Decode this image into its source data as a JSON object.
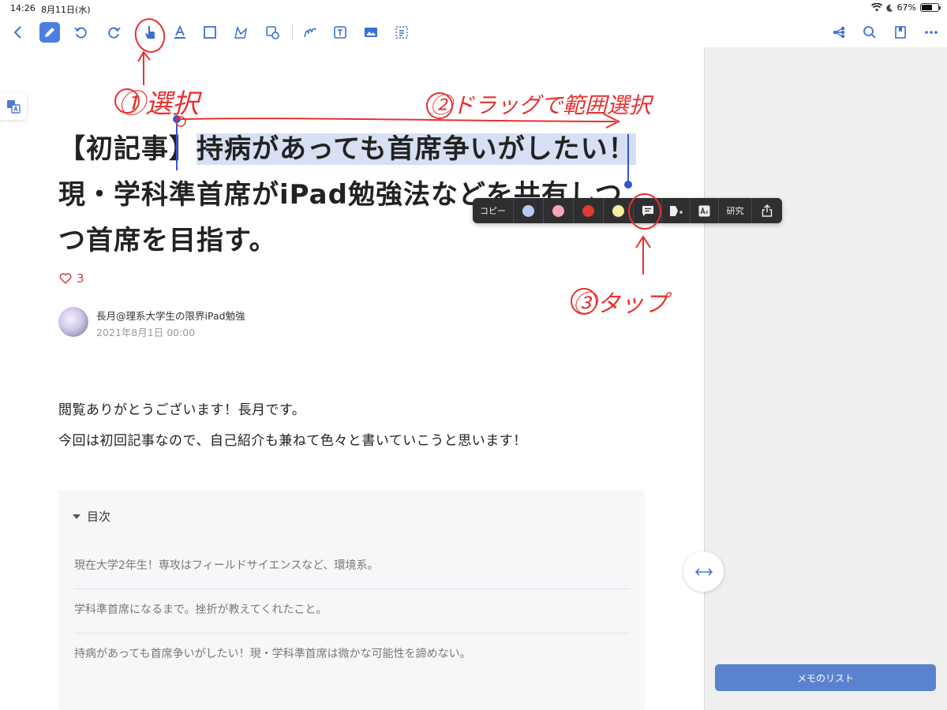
{
  "status_bar": {
    "time": "14:26",
    "date": "8月11日(水)",
    "battery": "67%",
    "battery_level": 0.67
  },
  "toolbar": {
    "left_icons": [
      "back-icon",
      "pen-icon",
      "undo-icon",
      "redo-icon",
      "pointer-hand-icon",
      "highlighter-icon",
      "rectangle-select-icon",
      "lasso-icon",
      "image-settings-icon",
      "freehand-icon",
      "text-box-icon",
      "image-icon",
      "scan-icon"
    ],
    "right_icons": [
      "share-icon",
      "search-icon",
      "bookmark-icon",
      "more-icon"
    ]
  },
  "article": {
    "title_prefix": "【初記事】",
    "title_highlighted": "持病があっても首席争いがしたい！",
    "title_line2": "現・学科準首席がiPad勉強法などを共有しつ",
    "title_line3": "つ首席を目指す。",
    "likes": "3",
    "author": "長月@理系大学生の限界iPad勉強",
    "date": "2021年8月1日 00:00",
    "para1": "閲覧ありがとうございます！長月です。",
    "para2": "今回は初回記事なので、自己紹介も兼ねて色々と書いていこうと思います！"
  },
  "toc": {
    "heading": "目次",
    "items": [
      "現在大学2年生！専攻はフィールドサイエンスなど、環境系。",
      "学科準首席になるまで。挫折が教えてくれたこと。",
      "持病があっても首席争いがしたい！現・学科準首席は微かな可能性を諦めない。"
    ]
  },
  "popup_menu": {
    "copy_label": "コピー",
    "colors": [
      "#b9c9f3",
      "#f2a6b6",
      "#e03a31",
      "#f8ee9e"
    ],
    "research_label": "研究"
  },
  "annotations": {
    "step1": "①選択",
    "step2": "②ドラッグで範囲選択",
    "step3": "③タップ"
  },
  "memo_button": "メモのリスト"
}
